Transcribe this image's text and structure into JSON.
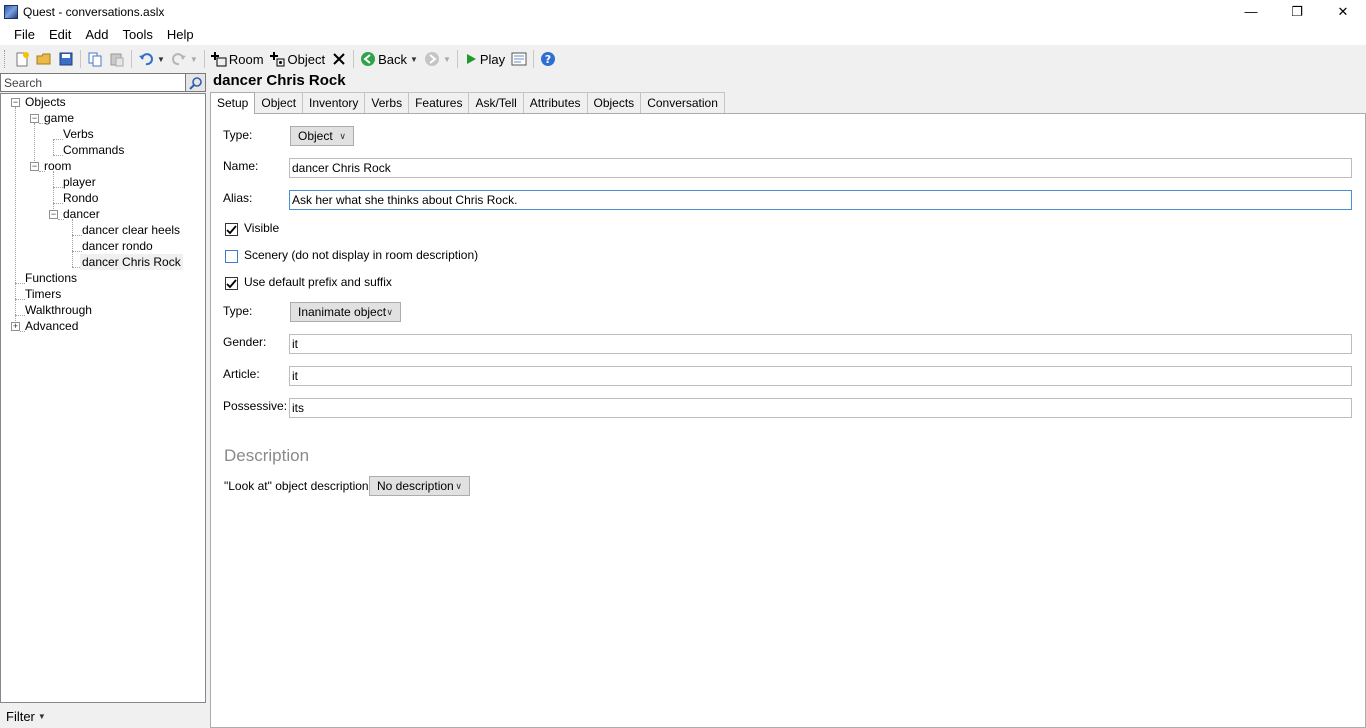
{
  "window": {
    "title": "Quest - conversations.aslx",
    "minimize": "—",
    "restore": "❐",
    "close": "✕"
  },
  "menu": [
    {
      "label": "File"
    },
    {
      "label": "Edit"
    },
    {
      "label": "Add"
    },
    {
      "label": "Tools"
    },
    {
      "label": "Help"
    }
  ],
  "toolbar": {
    "room_label": "Room",
    "object_label": "Object",
    "back_label": "Back",
    "play_label": "Play"
  },
  "search": {
    "placeholder": "Search"
  },
  "tree": {
    "objects": "Objects",
    "game": "game",
    "verbs": "Verbs",
    "commands": "Commands",
    "room": "room",
    "player": "player",
    "rondo": "Rondo",
    "dancer": "dancer",
    "dancer_clear_heels": "dancer clear heels",
    "dancer_rondo": "dancer rondo",
    "dancer_chris_rock": "dancer Chris Rock",
    "functions": "Functions",
    "timers": "Timers",
    "walkthrough": "Walkthrough",
    "advanced": "Advanced"
  },
  "filter": {
    "label": "Filter"
  },
  "editor": {
    "title": "dancer Chris Rock",
    "tabs": [
      "Setup",
      "Object",
      "Inventory",
      "Verbs",
      "Features",
      "Ask/Tell",
      "Attributes",
      "Objects",
      "Conversation"
    ],
    "type_label": "Type:",
    "type_value": "Object",
    "name_label": "Name:",
    "name_value": "dancer Chris Rock",
    "alias_label": "Alias:",
    "alias_value": "Ask her what she thinks about Chris Rock.",
    "visible_label": "Visible",
    "scenery_label": "Scenery (do not display in room description)",
    "prefix_label": "Use default prefix and suffix",
    "type2_label": "Type:",
    "type2_value": "Inanimate object",
    "gender_label": "Gender:",
    "gender_value": "it",
    "article_label": "Article:",
    "article_value": "it",
    "possessive_label": "Possessive:",
    "possessive_value": "its",
    "description_header": "Description",
    "look_label": "\"Look at\" object description:",
    "look_value": "No description"
  },
  "colors": {
    "accent": "#4a90d9",
    "selection": "#f0f0f0",
    "play": "#1f9a2a",
    "back": "#2fa34a"
  }
}
